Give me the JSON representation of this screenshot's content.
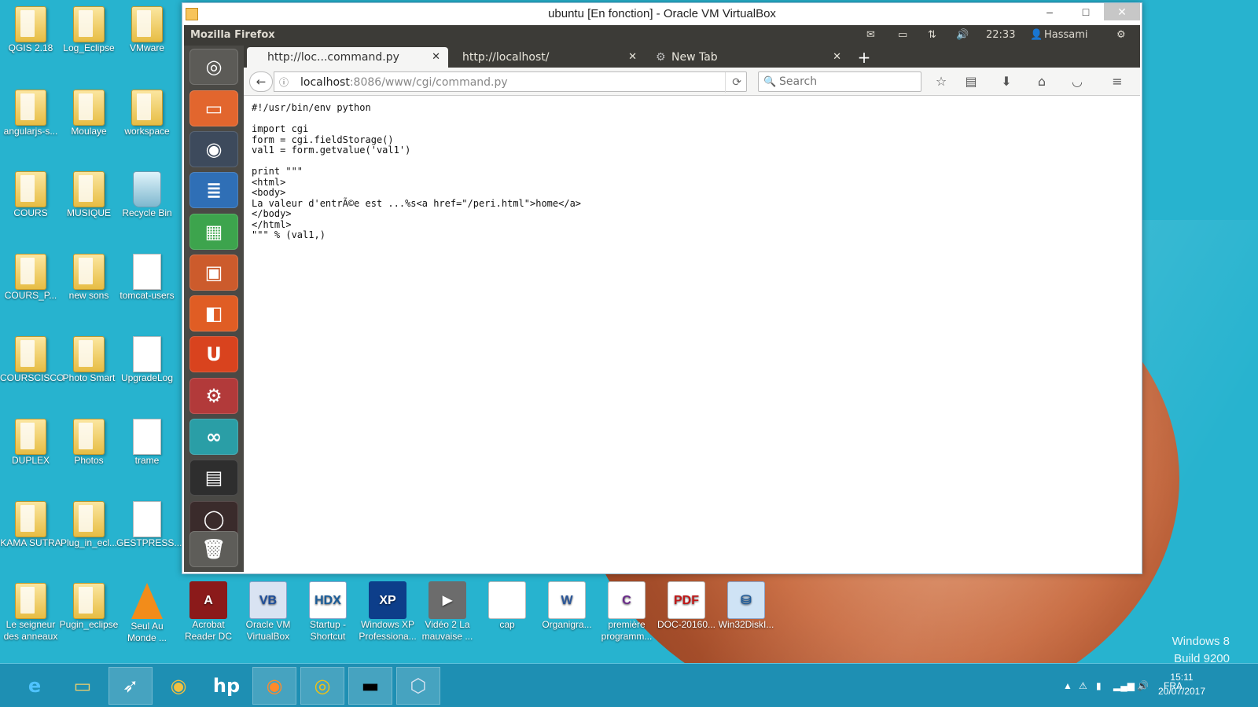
{
  "desktop": {
    "col1": [
      {
        "label": "QGIS 2.18",
        "kind": "folder"
      },
      {
        "label": "angularjs-s...",
        "kind": "folder"
      },
      {
        "label": "COURS",
        "kind": "folder"
      },
      {
        "label": "COURS_P...",
        "kind": "folder"
      },
      {
        "label": "COURSCISCO",
        "kind": "folder"
      },
      {
        "label": "DUPLEX",
        "kind": "folder"
      },
      {
        "label": "KAMA SUTRA",
        "kind": "folder"
      },
      {
        "label": "Le seigneur des anneaux",
        "kind": "folder"
      }
    ],
    "col2": [
      {
        "label": "Log_Eclipse",
        "kind": "folder"
      },
      {
        "label": "Moulaye",
        "kind": "folder"
      },
      {
        "label": "MUSIQUE",
        "kind": "folder"
      },
      {
        "label": "new sons",
        "kind": "folder"
      },
      {
        "label": "Photo Smart",
        "kind": "folder"
      },
      {
        "label": "Photos",
        "kind": "folder"
      },
      {
        "label": "Plug_in_ecl...",
        "kind": "folder"
      },
      {
        "label": "Pugin_eclipse",
        "kind": "folder"
      }
    ],
    "col3": [
      {
        "label": "VMware",
        "kind": "folder"
      },
      {
        "label": "workspace",
        "kind": "folder"
      },
      {
        "label": "Recycle Bin",
        "kind": "bin"
      },
      {
        "label": "tomcat-users",
        "kind": "doc"
      },
      {
        "label": "UpgradeLog",
        "kind": "doc"
      },
      {
        "label": "trame",
        "kind": "doc"
      },
      {
        "label": "GESTPRESS....",
        "kind": "doc"
      },
      {
        "label": "Seul Au Monde ...",
        "kind": "cone"
      }
    ],
    "bottom_row": [
      {
        "label": "Acrobat Reader DC"
      },
      {
        "label": "Oracle VM VirtualBox"
      },
      {
        "label": "Startup - Shortcut"
      },
      {
        "label": "Windows XP Professiona..."
      },
      {
        "label": "Vidéo 2 La mauvaise ..."
      },
      {
        "label": "cap"
      },
      {
        "label": "Organigra..."
      },
      {
        "label": "première programm..."
      },
      {
        "label": "DOC-20160..."
      },
      {
        "label": "Win32DiskI..."
      }
    ],
    "watermark": [
      "Windows 8",
      "Build 9200"
    ]
  },
  "vbox": {
    "title": "ubuntu [En fonction] - Oracle VM VirtualBox",
    "min": "–",
    "max": "□",
    "close": "✕"
  },
  "ubuntu_panel": {
    "app_title": "Mozilla Firefox",
    "time": "22:33",
    "user": "Hassami"
  },
  "firefox": {
    "tabs": [
      {
        "label": "http://loc...command.py",
        "active": true
      },
      {
        "label": "http://localhost/",
        "active": false
      },
      {
        "label": "New Tab",
        "active": false
      }
    ],
    "url_host": "localhost",
    "url_rest": ":8086/www/cgi/command.py",
    "search_placeholder": "Search",
    "source_code": "#!/usr/bin/env python\n\nimport cgi\nform = cgi.fieldStorage()\nval1 = form.getvalue('val1')\n\nprint \"\"\"\n<html>\n<body>\nLa valeur d'entrÃ©e est ...%s<a href=\"/peri.html\">home</a>\n</body>\n</html>\n\"\"\" % (val1,)"
  },
  "taskbar": {
    "lang": "FRA",
    "time": "15:11",
    "date": "20/07/2017"
  }
}
